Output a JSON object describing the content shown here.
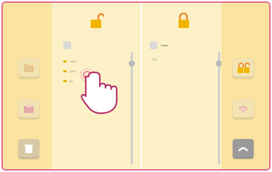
{
  "left_panel": {
    "items": [
      {
        "label": "1001"
      },
      {
        "label": "1002"
      },
      {
        "label": "30"
      }
    ]
  },
  "right_panel": {
    "file_label": "• Bsse",
    "sub_label": "- 1/10"
  },
  "icons": {
    "lock_open": "lock-open-icon",
    "lock_closed": "lock-closed-icon",
    "folder": "folder-icon",
    "trash": "trash-icon",
    "touch_hand": "touch-hand-icon",
    "undo": "undo-icon",
    "back": "back-arrow-icon"
  },
  "colors": {
    "accent": "#f1b400",
    "border": "#e2679a",
    "sidebar": "#fbe3a0",
    "panel": "#fcf0c6"
  }
}
